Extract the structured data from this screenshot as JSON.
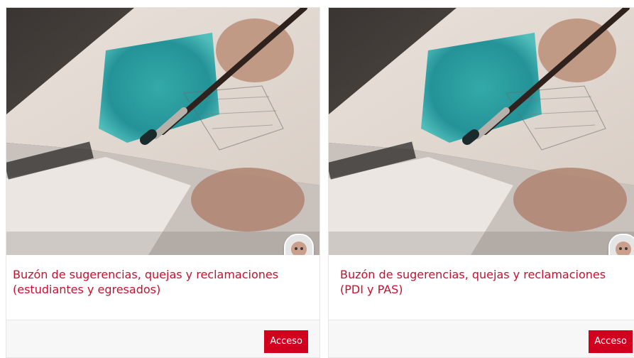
{
  "cards": [
    {
      "title": "Buzón de sugerencias, quejas y reclamaciones (estudiantes y egresados)",
      "button_label": "Acceso",
      "image_alt": "Mano pintando con pincel y acuarela azul sobre papel"
    },
    {
      "title": "Buzón de sugerencias, quejas y reclamaciones (PDI y PAS)",
      "button_label": "Acceso",
      "image_alt": "Mano pintando con pincel y acuarela azul sobre papel"
    }
  ],
  "colors": {
    "accent": "#c8102e",
    "button_bg": "#d2001e",
    "footer_bg": "#f7f7f7"
  }
}
